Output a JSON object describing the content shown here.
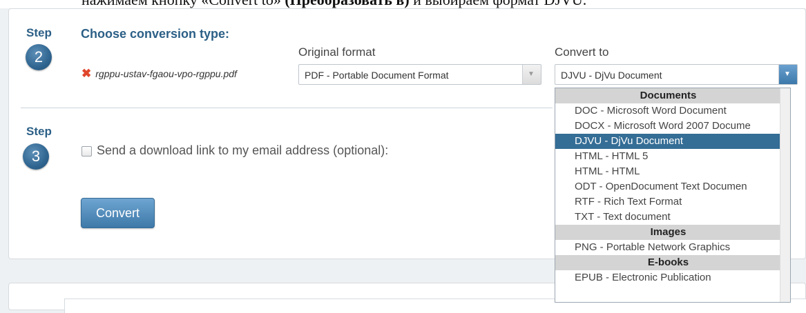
{
  "caption": {
    "text_before": "нажимаем кнопку «Convert to»",
    "text_bold": "(Преобразовать в)",
    "text_after": "и выбираем формат DJVU."
  },
  "step2": {
    "label": "Step",
    "number": "2",
    "title": "Choose conversion type:",
    "file_name": "rgppu-ustav-fgaou-vpo-rgppu.pdf",
    "remove_icon": "✖",
    "original_format": {
      "label": "Original format",
      "value": "PDF - Portable Document Format"
    },
    "convert_to": {
      "label": "Convert to",
      "value": "DJVU - DjVu Document"
    }
  },
  "step3": {
    "label": "Step",
    "number": "3",
    "email_label": "Send a download link to my email address (optional):",
    "convert_button": "Convert"
  },
  "dropdown": {
    "groups": [
      {
        "name": "Documents",
        "items": [
          {
            "label": "DOC - Microsoft Word Document",
            "selected": false
          },
          {
            "label": "DOCX - Microsoft Word 2007 Docume",
            "selected": false
          },
          {
            "label": "DJVU - DjVu Document",
            "selected": true
          },
          {
            "label": "HTML - HTML 5",
            "selected": false
          },
          {
            "label": "HTML - HTML",
            "selected": false
          },
          {
            "label": "ODT - OpenDocument Text Documen",
            "selected": false
          },
          {
            "label": "RTF - Rich Text Format",
            "selected": false
          },
          {
            "label": "TXT - Text document",
            "selected": false
          }
        ]
      },
      {
        "name": "Images",
        "items": [
          {
            "label": "PNG - Portable Network Graphics",
            "selected": false
          }
        ]
      },
      {
        "name": "E-books",
        "items": [
          {
            "label": "EPUB - Electronic Publication",
            "selected": false
          }
        ]
      }
    ]
  },
  "colors": {
    "accent": "#2b5f86",
    "selected_option": "#346d96",
    "remove_icon": "#e0462b"
  }
}
